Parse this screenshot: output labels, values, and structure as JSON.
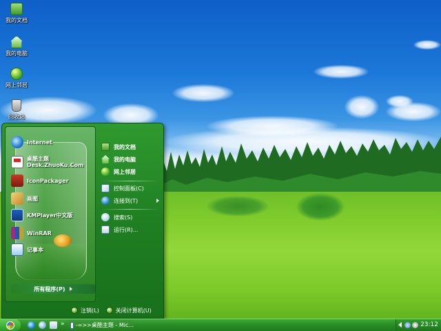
{
  "desktop": {
    "icons": [
      {
        "label": "我的文档",
        "icon": "folder-icon"
      },
      {
        "label": "我的电脑",
        "icon": "computer-icon"
      },
      {
        "label": "网上邻居",
        "icon": "network-icon"
      },
      {
        "label": "回收站",
        "icon": "recycle-bin-icon"
      }
    ]
  },
  "start_menu": {
    "programs": [
      {
        "label": "Internet",
        "icon": "internet-explorer-icon"
      },
      {
        "label": "桌酷主题",
        "label2": "Desk.ZhuoKu.Com",
        "icon": "theme-icon"
      },
      {
        "label": "IconPackager",
        "icon": "iconpackager-icon"
      },
      {
        "label": "画图",
        "icon": "paint-icon"
      },
      {
        "label": "KMPlayer中文版",
        "icon": "kmplayer-icon"
      },
      {
        "label": "WinRAR",
        "icon": "winrar-icon"
      },
      {
        "label": "记事本",
        "icon": "notepad-icon"
      }
    ],
    "all_programs": "所有程序(P)",
    "places": [
      {
        "label": "我的文档",
        "icon": "folder-icon"
      },
      {
        "label": "我的电脑",
        "icon": "computer-icon"
      },
      {
        "label": "网上邻居",
        "icon": "network-icon"
      }
    ],
    "system": [
      {
        "label": "控制面板(C)",
        "icon": "control-panel-icon"
      },
      {
        "label": "连接到(T)",
        "icon": "connect-icon"
      }
    ],
    "tools": [
      {
        "label": "搜索(S)",
        "icon": "search-icon"
      },
      {
        "label": "运行(R)...",
        "icon": "run-icon"
      }
    ],
    "logoff": "注销(L)",
    "shutdown": "关闭计算机(U)"
  },
  "taskbar": {
    "quick_launch_more": "»",
    "task_button": "-=>>桌酷主题 - Mic...",
    "clock": "23:12"
  },
  "colors": {
    "menu_green": "#1f7f22",
    "taskbar_green": "#2a8e27",
    "sky_blue": "#1c78d8"
  }
}
